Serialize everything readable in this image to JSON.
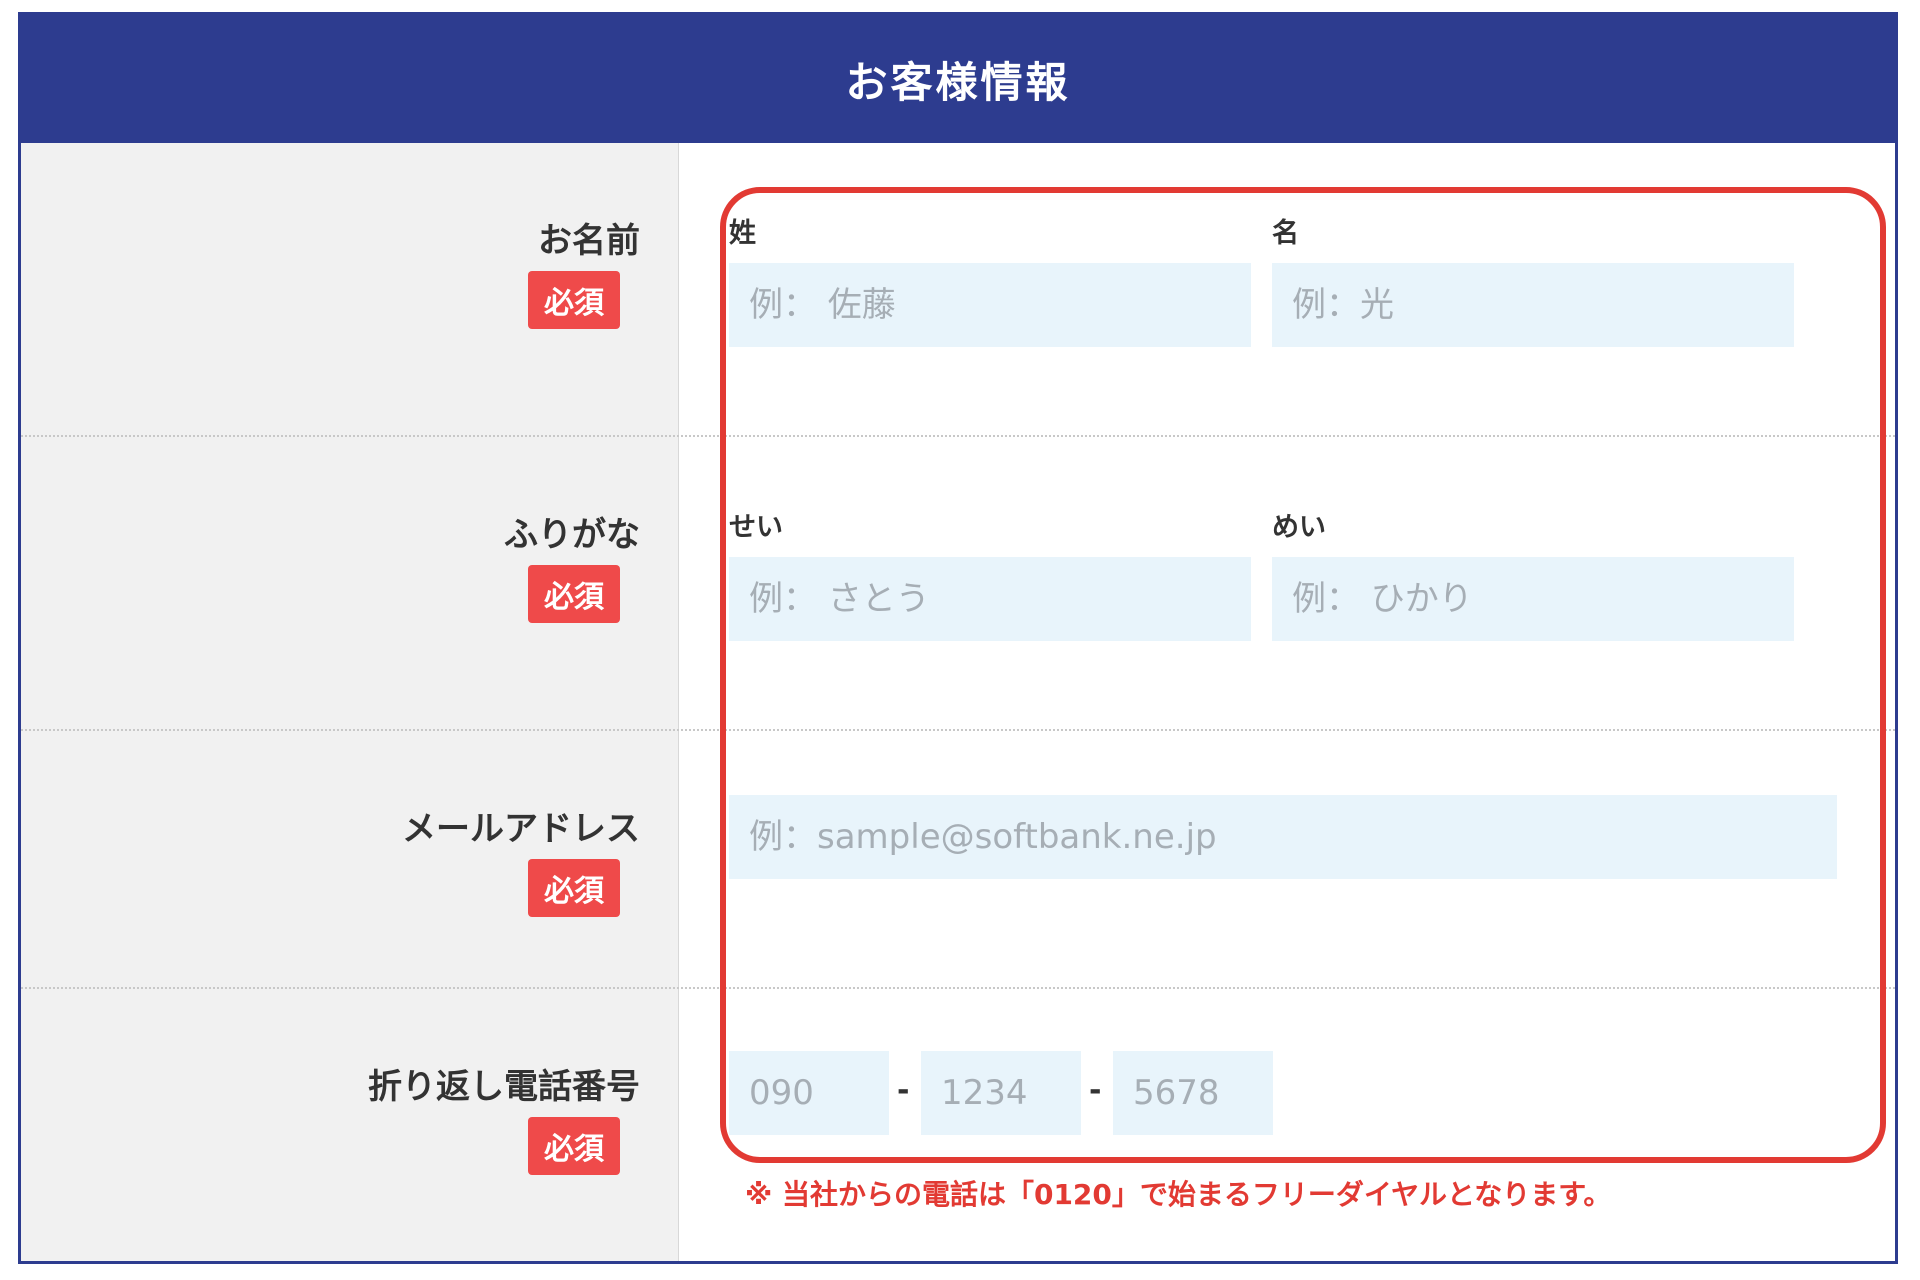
{
  "header": {
    "title": "お客様情報"
  },
  "required_badge": "必須",
  "name": {
    "label": "お名前",
    "last": {
      "label": "姓",
      "placeholder": "例： 佐藤"
    },
    "first": {
      "label": "名",
      "placeholder": "例：光"
    }
  },
  "furigana": {
    "label": "ふりがな",
    "last": {
      "label": "せい",
      "placeholder": "例： さとう"
    },
    "first": {
      "label": "めい",
      "placeholder": "例： ひかり"
    }
  },
  "email": {
    "label": "メールアドレス",
    "placeholder": "例：sample@softbank.ne.jp"
  },
  "phone": {
    "label": "折り返し電話番号",
    "part1_placeholder": "090",
    "part2_placeholder": "1234",
    "part3_placeholder": "5678",
    "separator": "-",
    "note": "※ 当社からの電話は「0120」で始まるフリーダイヤルとなります。"
  },
  "colors": {
    "header_bg": "#2d3c8f",
    "badge_bg": "#ef4a4a",
    "field_bg": "#e8f4fb",
    "highlight": "#e23a33"
  }
}
